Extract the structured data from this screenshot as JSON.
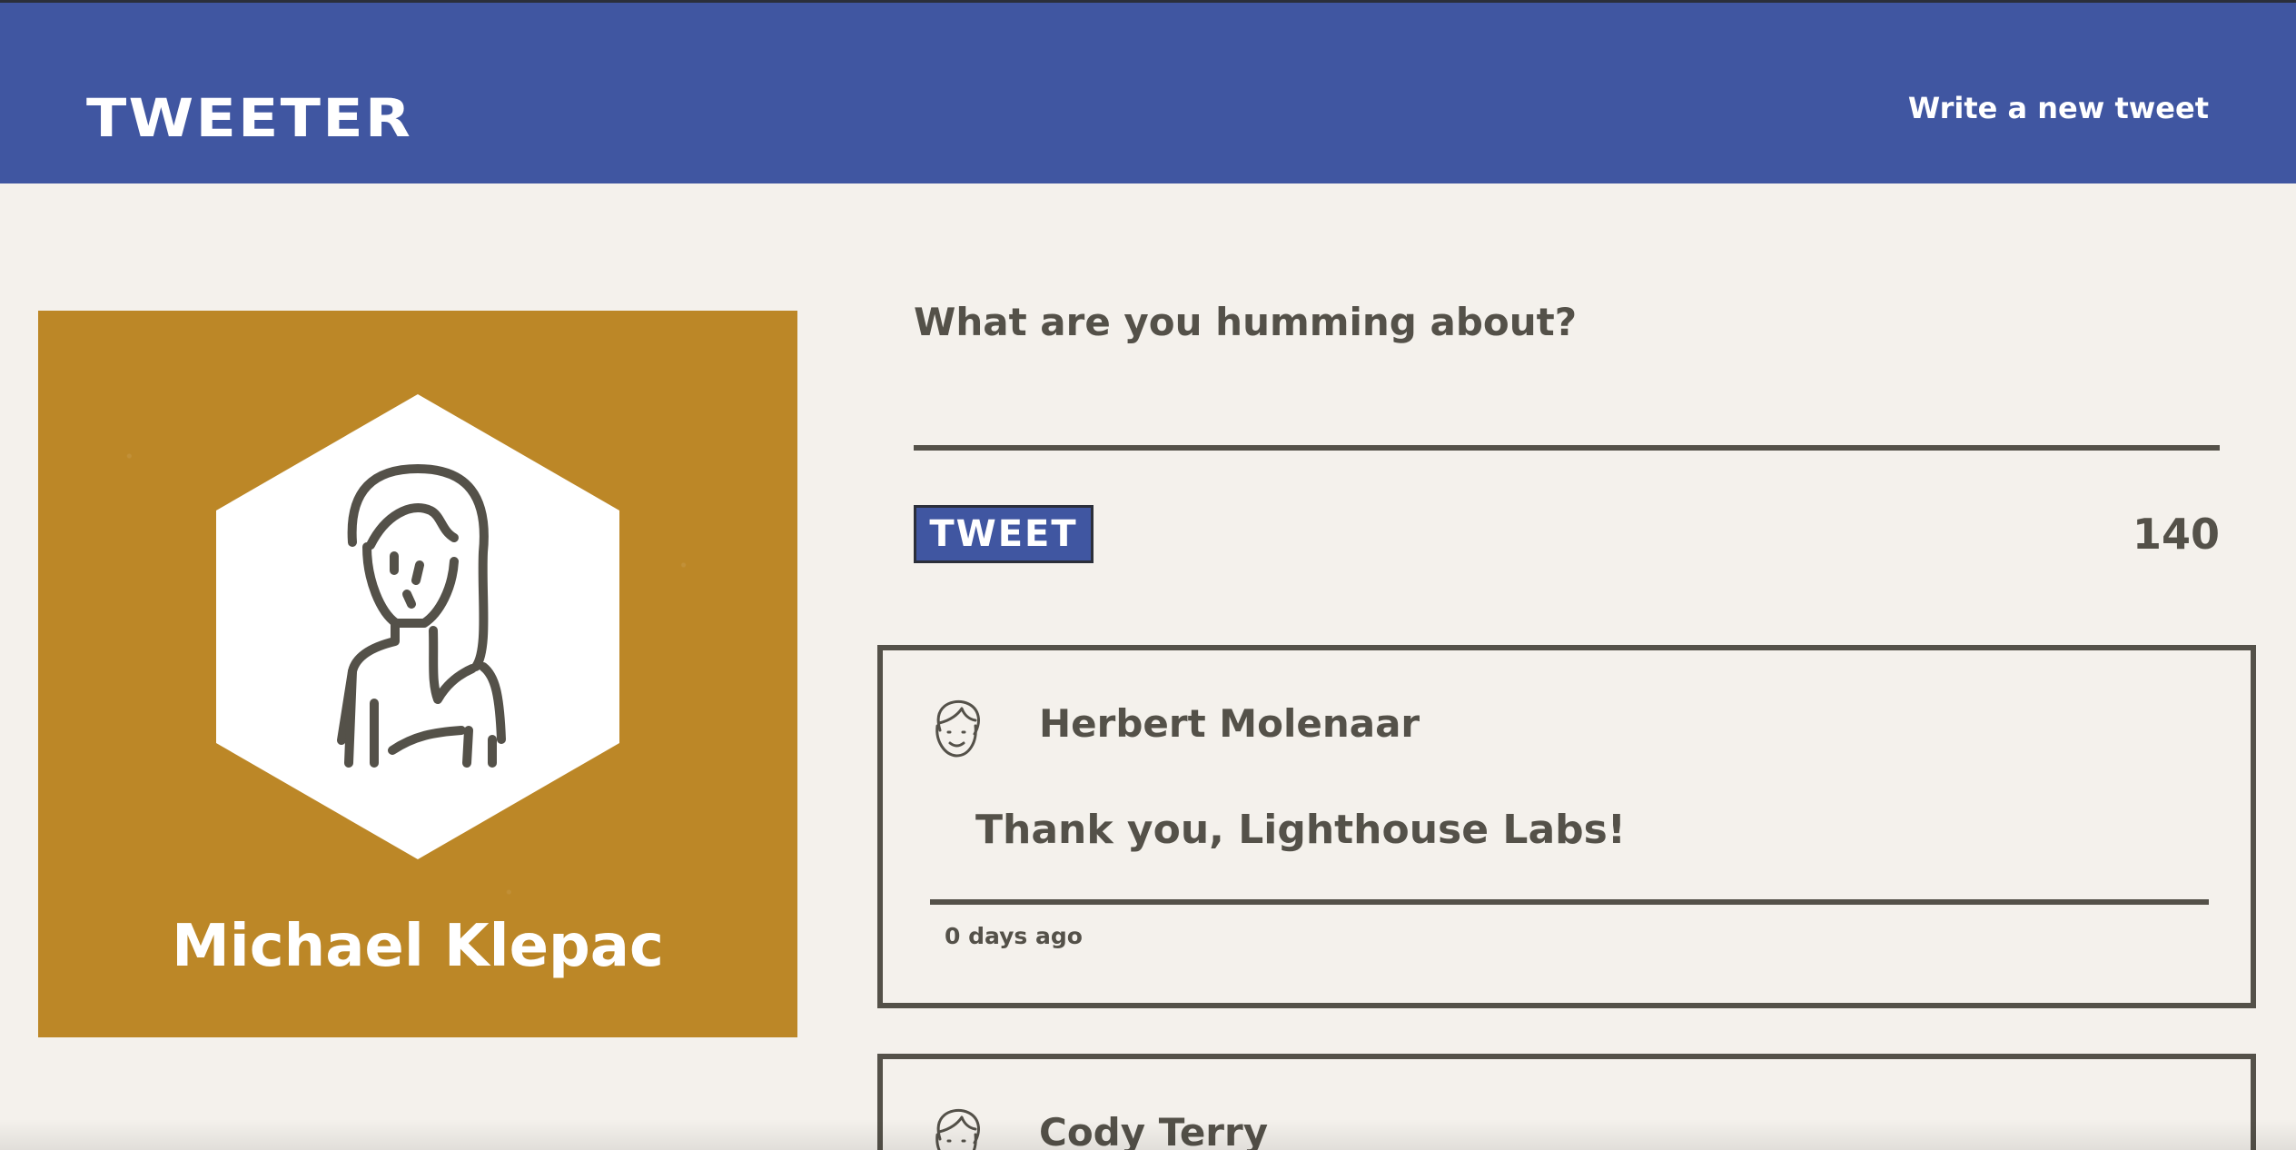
{
  "nav": {
    "brand": "TWEETER",
    "write_link": "Write a new tweet"
  },
  "profile": {
    "name": "Michael Klepac",
    "avatar_icon": "female-user-avatar-icon"
  },
  "composer": {
    "label": "What are you humming about?",
    "value": "",
    "button_label": "TWEET",
    "counter": "140"
  },
  "tweets": [
    {
      "author": "Herbert Molenaar",
      "content": "Thank you, Lighthouse Labs!",
      "time": "0 days ago",
      "avatar_icon": "male-user-avatar-icon"
    },
    {
      "author": "Cody Terry",
      "avatar_icon": "male-user-avatar-icon"
    }
  ],
  "colors": {
    "nav_background": "#4056a1",
    "page_background": "#f4f1ec",
    "profile_background": "#bc8727",
    "text": "#545149",
    "white": "#ffffff"
  }
}
